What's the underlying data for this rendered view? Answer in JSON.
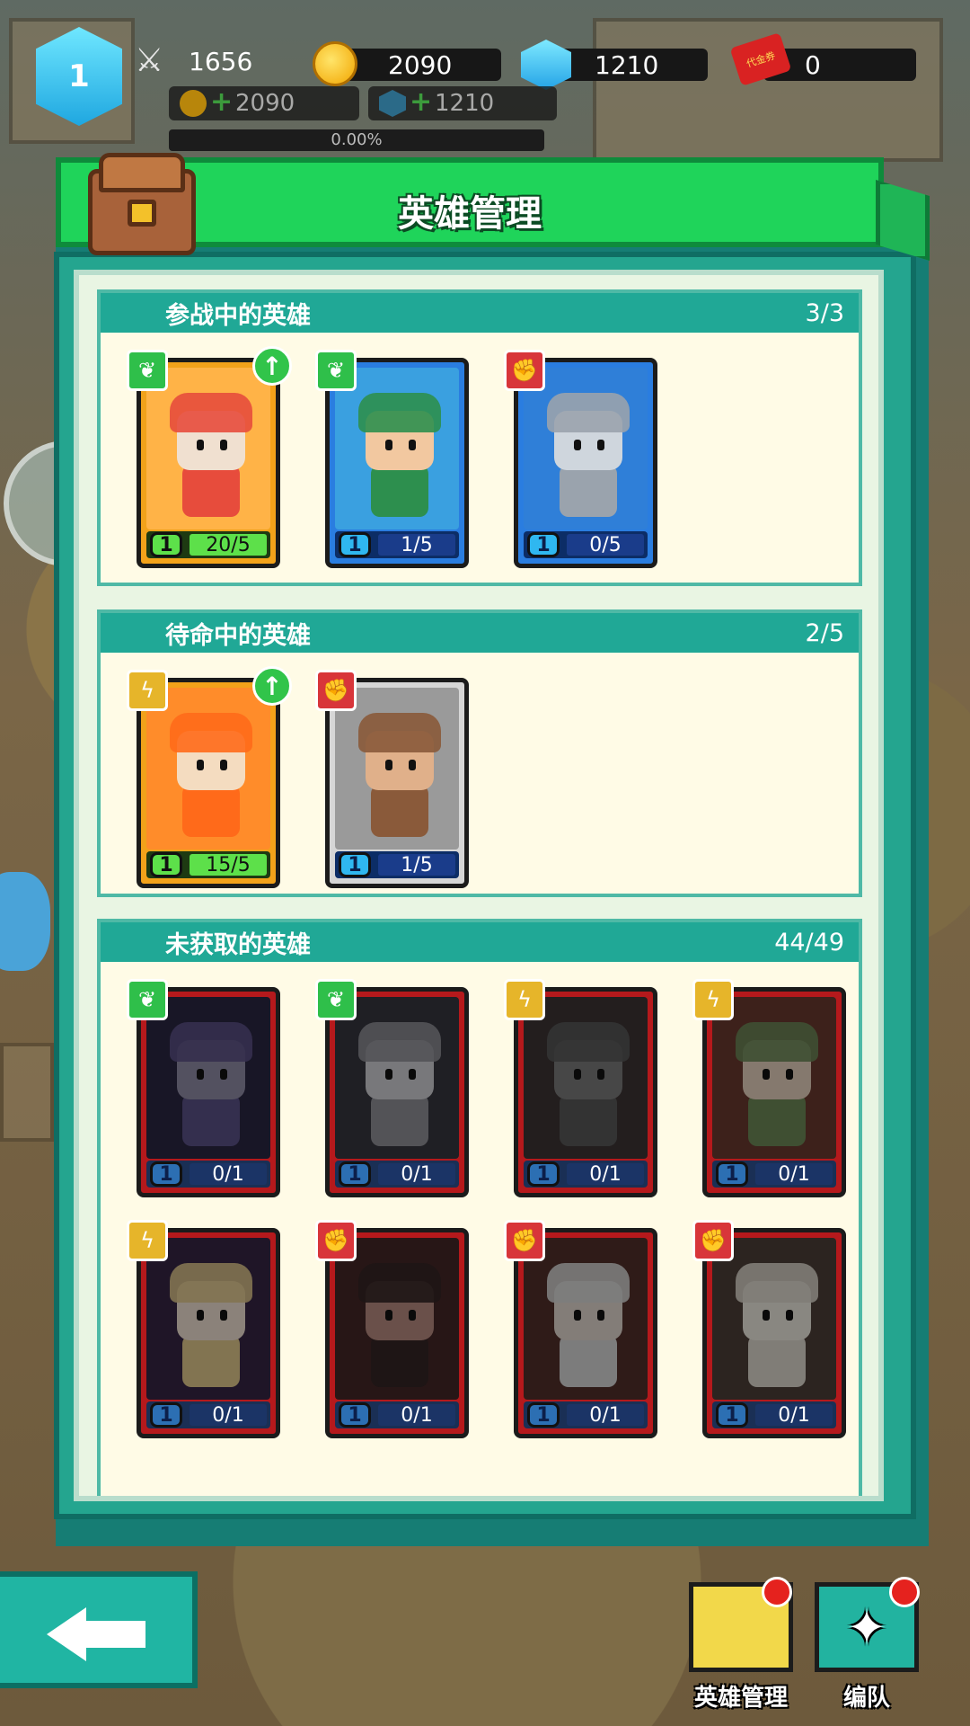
{
  "top_bar": {
    "level": "1",
    "power": "1656",
    "gold": "2090",
    "gems": "1210",
    "vouchers": "0",
    "voucher_icon_text": "代金券",
    "gold_income": "2090",
    "gem_income": "1210",
    "exp_progress": "0.00%"
  },
  "panel": {
    "title": "英雄管理"
  },
  "sections": {
    "active": {
      "label": "参战中的英雄",
      "count": "3/3"
    },
    "standby": {
      "label": "待命中的英雄",
      "count": "2/5"
    },
    "locked": {
      "label": "未获取的英雄",
      "count": "44/49"
    }
  },
  "active_heroes": [
    {
      "type": "leaf-icon",
      "level": "1",
      "progress": "20/5",
      "rarity": "gold",
      "upgradable": true
    },
    {
      "type": "leaf-icon",
      "level": "1",
      "progress": "1/5",
      "rarity": "blue",
      "upgradable": false
    },
    {
      "type": "fist-icon",
      "level": "1",
      "progress": "0/5",
      "rarity": "blue",
      "upgradable": false
    }
  ],
  "standby_heroes": [
    {
      "type": "bolt-icon",
      "level": "1",
      "progress": "15/5",
      "rarity": "gold",
      "upgradable": true
    },
    {
      "type": "fist-icon",
      "level": "1",
      "progress": "1/5",
      "rarity": "gray",
      "upgradable": false
    }
  ],
  "locked_heroes": [
    {
      "type": "leaf-icon",
      "level": "1",
      "progress": "0/1"
    },
    {
      "type": "leaf-icon",
      "level": "1",
      "progress": "0/1"
    },
    {
      "type": "bolt-icon",
      "level": "1",
      "progress": "0/1"
    },
    {
      "type": "bolt-icon",
      "level": "1",
      "progress": "0/1"
    },
    {
      "type": "bolt-icon",
      "level": "1",
      "progress": "0/1"
    },
    {
      "type": "fist-icon",
      "level": "1",
      "progress": "0/1"
    },
    {
      "type": "fist-icon",
      "level": "1",
      "progress": "0/1"
    },
    {
      "type": "fist-icon",
      "level": "1",
      "progress": "0/1"
    }
  ],
  "bottom_nav": {
    "hero_manage_label": "英雄管理",
    "formation_label": "编队"
  },
  "colors": {
    "title_green": "#1fd45a",
    "panel_teal": "#24a58f",
    "section_head": "#20a896",
    "notify_red": "#e5221e"
  }
}
